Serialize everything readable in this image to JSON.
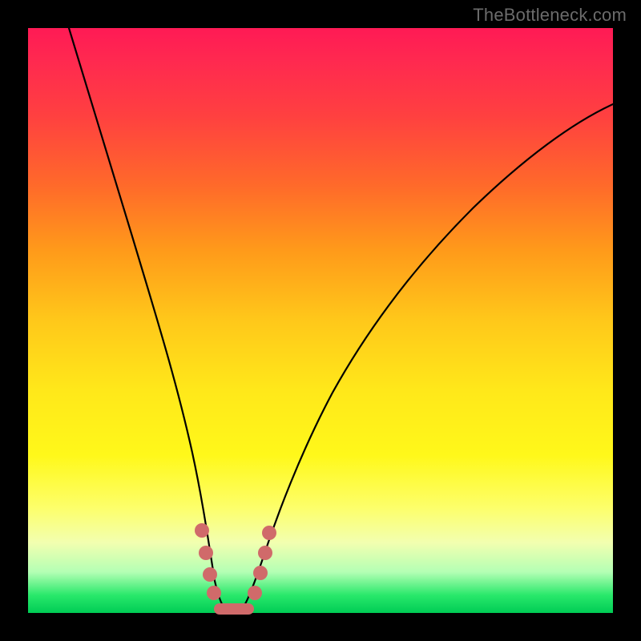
{
  "watermark_text": "TheBottleneck.com",
  "chart_data": {
    "type": "line",
    "title": "",
    "xlabel": "",
    "ylabel": "",
    "xlim": [
      0,
      100
    ],
    "ylim": [
      0,
      100
    ],
    "grid": false,
    "series": [
      {
        "name": "bottleneck-curve",
        "x": [
          7,
          10,
          14,
          18,
          22,
          25,
          27,
          29,
          30.5,
          32,
          33.5,
          35.5,
          38,
          41,
          45,
          50,
          56,
          63,
          71,
          80,
          90,
          100
        ],
        "y": [
          100,
          90,
          78,
          64,
          48,
          34,
          24,
          14,
          7,
          2,
          0.5,
          0.5,
          2,
          8,
          18,
          30,
          42,
          53,
          63,
          71,
          77,
          81
        ]
      }
    ],
    "markers": {
      "name": "highlight-region",
      "points": [
        {
          "x": 29.2,
          "y": 12
        },
        {
          "x": 30.0,
          "y": 7
        },
        {
          "x": 30.8,
          "y": 3
        },
        {
          "x": 31.5,
          "y": 1.2
        },
        {
          "x": 32.5,
          "y": 0.5
        },
        {
          "x": 33.8,
          "y": 0.5
        },
        {
          "x": 35.2,
          "y": 0.5
        },
        {
          "x": 36.5,
          "y": 0.5
        },
        {
          "x": 37.5,
          "y": 1.5
        },
        {
          "x": 38.6,
          "y": 4
        },
        {
          "x": 39.5,
          "y": 8
        },
        {
          "x": 40.3,
          "y": 12
        }
      ],
      "color": "#d06a6a"
    },
    "background_gradient": {
      "top": "#ff1a55",
      "mid": "#ffe81a",
      "bottom": "#00cc55"
    }
  }
}
